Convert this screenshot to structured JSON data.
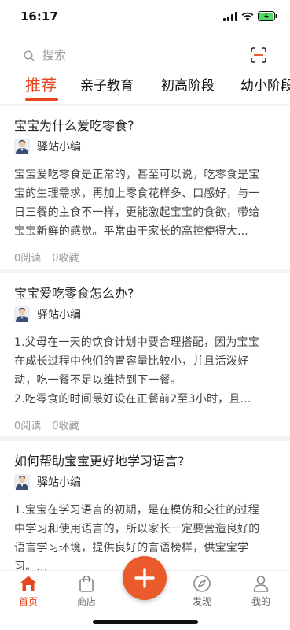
{
  "status_bar": {
    "time": "16:17"
  },
  "search": {
    "placeholder": "搜索"
  },
  "tabs": [
    {
      "label": "推荐",
      "active": true
    },
    {
      "label": "亲子教育",
      "active": false
    },
    {
      "label": "初高阶段",
      "active": false
    },
    {
      "label": "幼小阶段",
      "active": false
    }
  ],
  "articles": [
    {
      "title": "宝宝为什么爱吃零食?",
      "author": "驿站小编",
      "lines": [
        "宝宝爱吃零食是正常的，甚至可以说，吃零食是宝",
        "宝的生理需求，再加上零食花样多、口感好，与一",
        "日三餐的主食不一样，更能激起宝宝的食欲，带给",
        "宝宝新鲜的感觉。平常由于家长的高控使得大..."
      ],
      "reads": "0阅读",
      "favorites": "0收藏"
    },
    {
      "title": "宝宝爱吃零食怎么办?",
      "author": "驿站小编",
      "lines": [
        "1.父母在一天的饮食计划中要合理搭配，因为宝宝",
        "在成长过程中他们的胃容量比较小，并且活泼好",
        "动，吃一餐不足以维持到下一餐。",
        "2.吃零食的时间最好设在正餐前2至3小时，且..."
      ],
      "reads": "0阅读",
      "favorites": "0收藏"
    },
    {
      "title": "如何帮助宝宝更好地学习语言?",
      "author": "驿站小编",
      "lines": [
        "1.宝宝在学习语言的初期，是在模仿和交往的过程",
        "中学习和使用语言的，所以家长一定要营造良好的",
        "语言学习环境，提供良好的言语榜样，供宝宝学",
        "习。..."
      ]
    }
  ],
  "bottom_nav": [
    {
      "label": "首页",
      "icon": "home-icon",
      "active": true
    },
    {
      "label": "商店",
      "icon": "shopping-bag-icon",
      "active": false
    },
    {
      "label": "",
      "icon": "plus-icon",
      "active": false
    },
    {
      "label": "发现",
      "icon": "compass-icon",
      "active": false
    },
    {
      "label": "我的",
      "icon": "person-icon",
      "active": false
    }
  ],
  "colors": {
    "accent": "#e8451e",
    "fab": "#ea5a2a",
    "background": "#f4f4f4"
  }
}
